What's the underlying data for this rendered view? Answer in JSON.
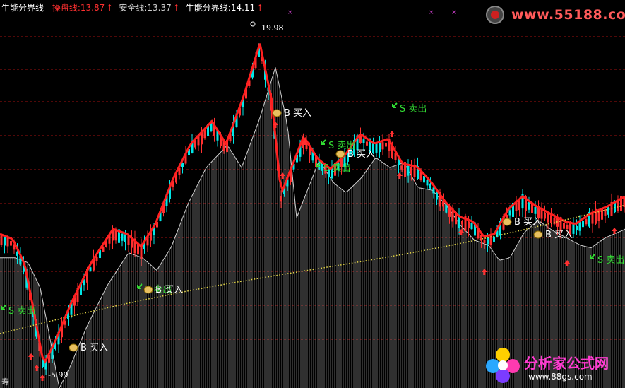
{
  "header": {
    "indicator_name": "牛能分界线",
    "lines": [
      {
        "label": "操盘线:13.87",
        "color": "#ff3030",
        "arrow": "↑"
      },
      {
        "label": "安全线:13.37",
        "color": "#cfcfcf",
        "arrow": "↑"
      },
      {
        "label": "牛能分界线:14.11",
        "color": "#ffffff",
        "arrow": "↑"
      }
    ]
  },
  "watermark_top": "www.55188.com",
  "watermark_bottom": {
    "title": "分析家公式网",
    "url": "www.88gs.com"
  },
  "corner_label": "寿",
  "chart_data": {
    "type": "line",
    "price_high": {
      "label": "19.98"
    },
    "price_low": {
      "label": "5.99"
    },
    "signals": [
      {
        "type": "sell",
        "label": "S 卖出"
      },
      {
        "type": "buy",
        "label": "B 买入"
      },
      {
        "type": "sell",
        "label": "S 卖出"
      },
      {
        "type": "buy",
        "label": "B 买入"
      },
      {
        "type": "sell",
        "label": "S 卖出"
      },
      {
        "type": "sell",
        "label": "S 卖出"
      },
      {
        "type": "buy",
        "label": "B 买入"
      },
      {
        "type": "sell",
        "label": "S 卖出"
      },
      {
        "type": "buy",
        "label": "B 买入"
      },
      {
        "type": "buy",
        "label": "B 买入"
      },
      {
        "type": "sell",
        "label": "S 卖出"
      },
      {
        "type": "buy",
        "label": "B 买入"
      }
    ],
    "colors": {
      "up": "#ff3030",
      "down": "#00e6e6",
      "trend": "#ff2020",
      "safety": "#d0d0d0",
      "divider": "#e6d84a",
      "grid": "#a01010",
      "buy": "#ffffff",
      "sell": "#33dd33"
    }
  }
}
